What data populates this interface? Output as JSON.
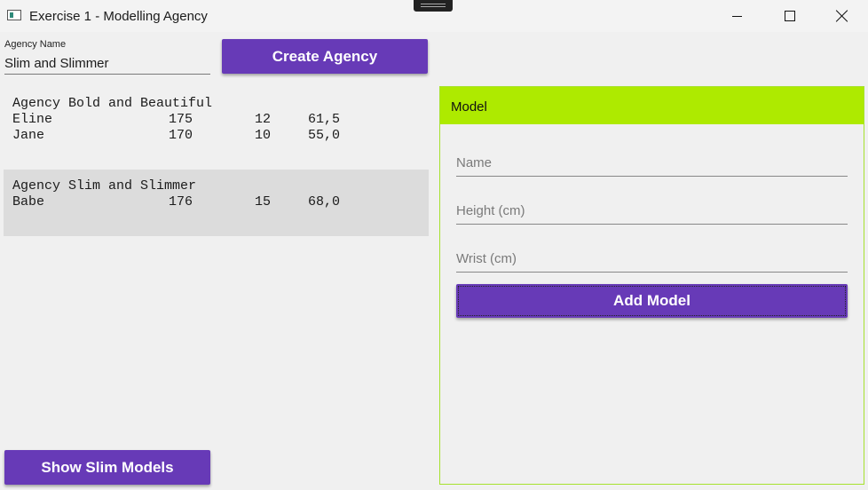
{
  "window": {
    "title": "Exercise 1 - Modelling Agency"
  },
  "form": {
    "agency_name_label": "Agency Name",
    "agency_name_value": "Slim and Slimmer",
    "create_button": "Create Agency"
  },
  "agencies": [
    {
      "header": "Agency Bold and Beautiful",
      "models": [
        {
          "name": "Eline",
          "height": "175",
          "wrist": "12",
          "bmi": "61,5"
        },
        {
          "name": "Jane",
          "height": "170",
          "wrist": "10",
          "bmi": "55,0"
        }
      ]
    },
    {
      "header": "Agency Slim and Slimmer",
      "models": [
        {
          "name": "Babe",
          "height": "176",
          "wrist": "15",
          "bmi": "68,0"
        }
      ]
    }
  ],
  "model_card": {
    "header": "Model",
    "name_placeholder": "Name",
    "height_placeholder": "Height (cm)",
    "wrist_placeholder": "Wrist (cm)",
    "add_button": "Add Model"
  },
  "show_slim_button": "Show Slim Models",
  "colors": {
    "accent": "#673ab7",
    "card_header": "#aeea00",
    "selected_row": "#dcdcdc"
  }
}
